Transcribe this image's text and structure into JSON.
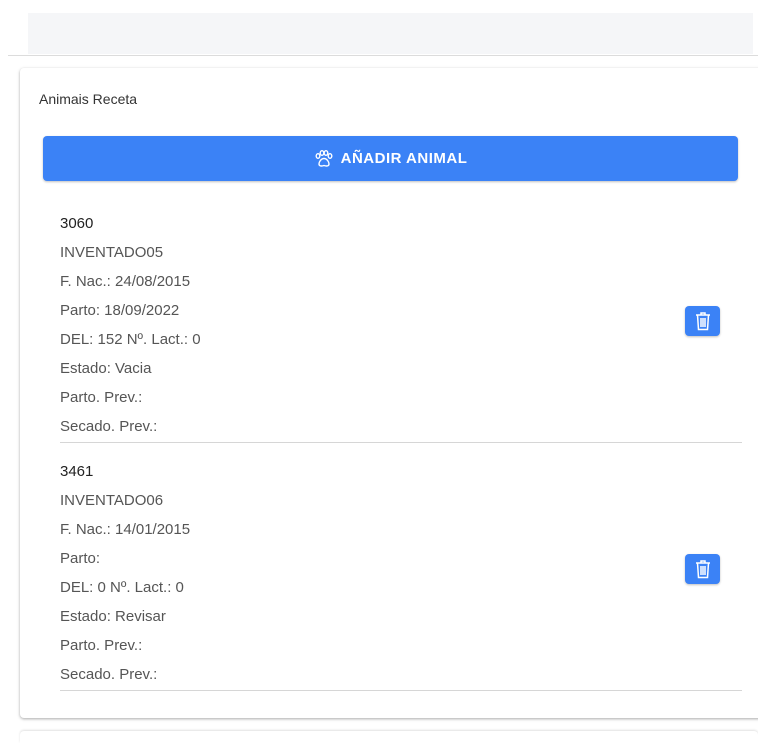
{
  "card": {
    "title": "Animais Receta",
    "add_button_label": "AÑADIR ANIMAL",
    "add_button_icon": "paw-icon",
    "accent_color": "#3b82f6"
  },
  "animals": [
    {
      "id": "3060",
      "name": "INVENTADO05",
      "birth": "F. Nac.: 24/08/2015",
      "parto": "Parto: 18/09/2022",
      "del_lact": "DEL: 152 Nº. Lact.: 0",
      "estado": "Estado: Vacia",
      "parto_prev": "Parto. Prev.:",
      "secado_prev": "Secado. Prev.:",
      "delete_icon": "trash-icon"
    },
    {
      "id": "3461",
      "name": "INVENTADO06",
      "birth": "F. Nac.: 14/01/2015",
      "parto": "Parto:",
      "del_lact": "DEL: 0 Nº. Lact.: 0",
      "estado": "Estado: Revisar",
      "parto_prev": "Parto. Prev.:",
      "secado_prev": "Secado. Prev.:",
      "delete_icon": "trash-icon"
    }
  ]
}
